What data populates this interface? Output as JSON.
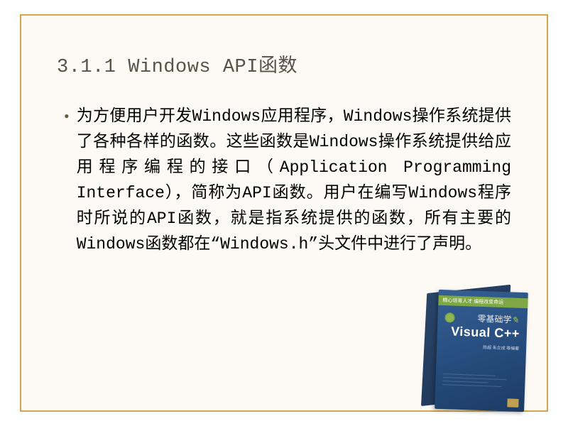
{
  "heading": "3.1.1  Windows API函数",
  "body": "为方便用户开发Windows应用程序，Windows操作系统提供了各种各样的函数。这些函数是Windows操作系统提供给应用程序编程的接口（Application Programming Interface），简称为API函数。用户在编写Windows程序时所说的API函数，就是指系统提供的函数，所有主要的Windows函数都在“Windows.h”头文件中进行了声明。",
  "bullet": "•",
  "book": {
    "band_text": "精心培育人才 编程改变命运",
    "subtitle_prefix": "零基础学",
    "title": "Visual C++",
    "author": "陈超 朱立成 等编著"
  }
}
